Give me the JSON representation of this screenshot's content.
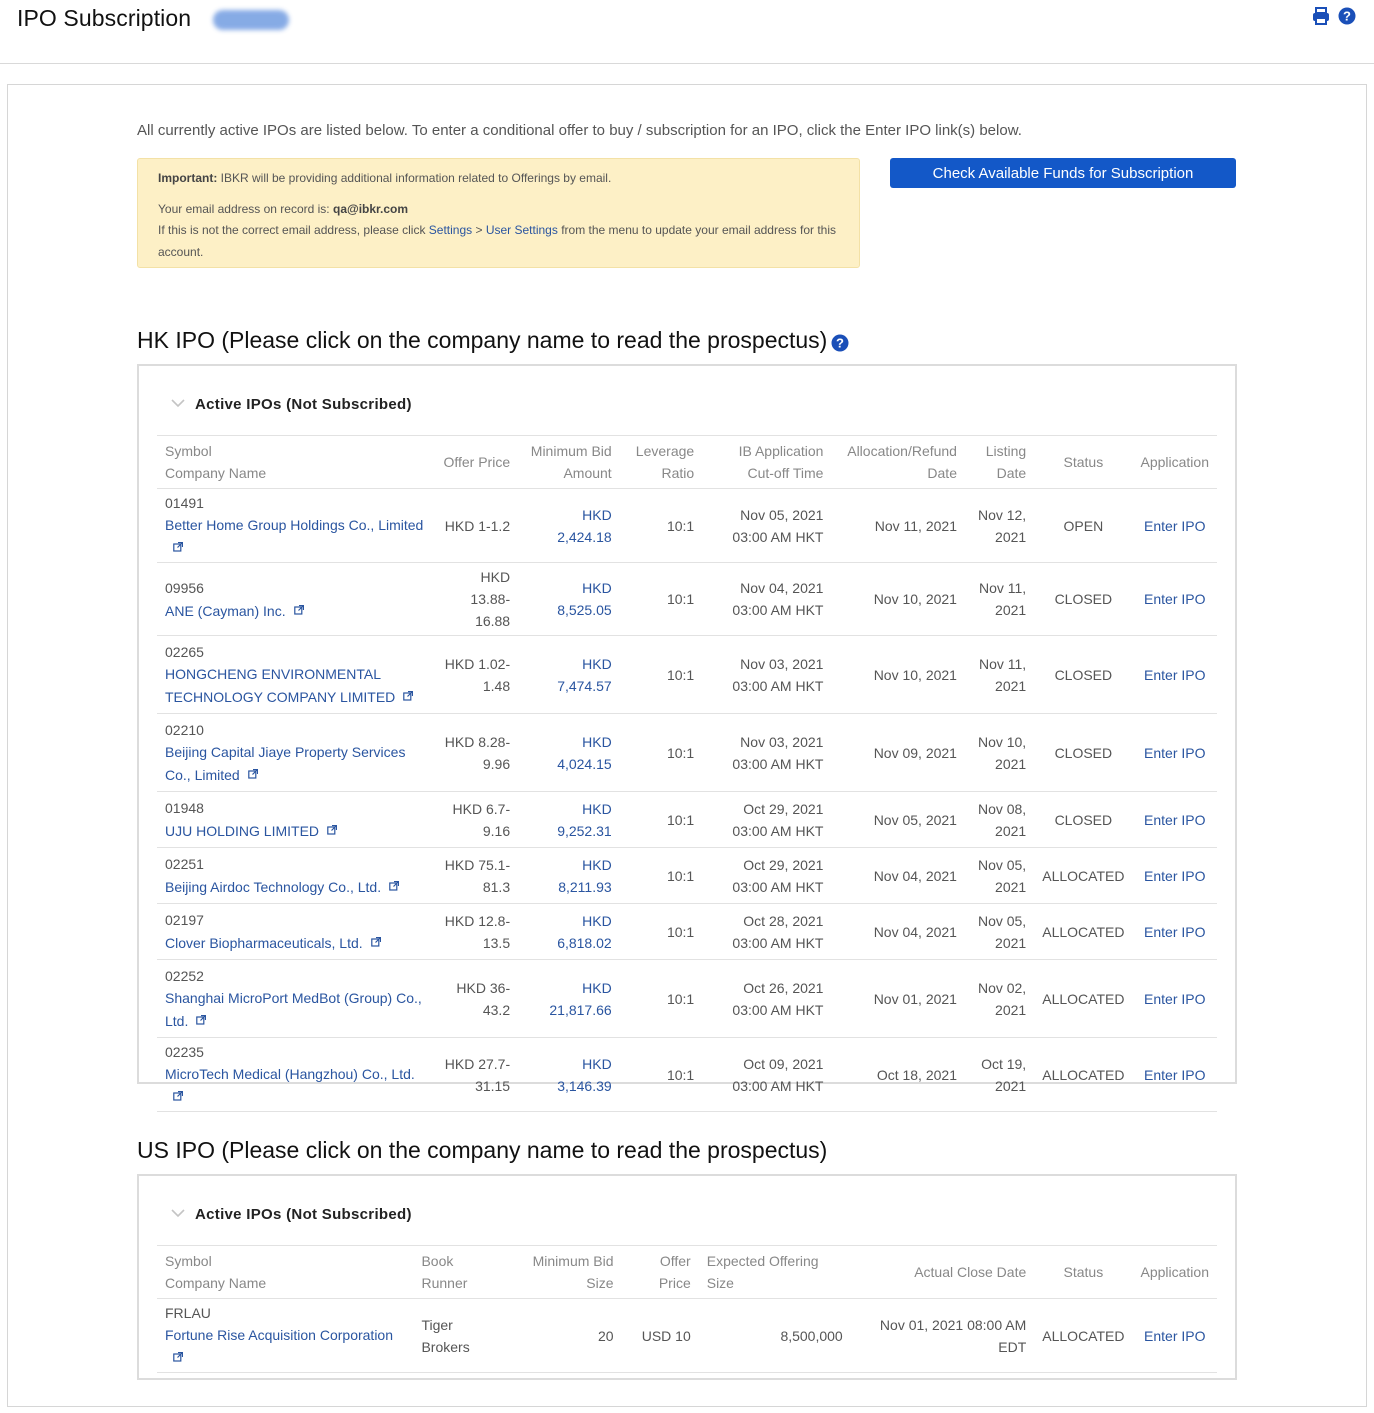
{
  "header": {
    "title": "IPO Subscription",
    "icons": [
      "print-icon",
      "help-icon"
    ]
  },
  "intro": "All currently active IPOs are listed below. To enter a conditional offer to buy / subscription for an IPO, click the Enter IPO link(s) below.",
  "notice": {
    "important_label": "Important:",
    "important_text": " IBKR will be providing additional information related to Offerings by email.",
    "email_label": "Your email address on record is: ",
    "email": "qa@ibkr.com",
    "line3_prefix": "If this is not the correct email address, please click ",
    "settings_link": "Settings",
    "separator": " > ",
    "user_settings_link": "User Settings",
    "line3_suffix": " from the menu to update your email address for this account."
  },
  "funds_button": "Check Available Funds for Subscription",
  "hk": {
    "title": "HK IPO (Please click on the company name to read the prospectus)",
    "panel_title": "Active IPOs (Not Subscribed)",
    "headers": {
      "symbol": "Symbol",
      "company": "Company Name",
      "offer_price": "Offer Price",
      "min_bid_1": "Minimum Bid",
      "min_bid_2": "Amount",
      "leverage_1": "Leverage",
      "leverage_2": "Ratio",
      "cutoff_1": "IB Application",
      "cutoff_2": "Cut-off Time",
      "alloc_1": "Allocation/Refund",
      "alloc_2": "Date",
      "listing_1": "Listing",
      "listing_2": "Date",
      "status": "Status",
      "application": "Application"
    },
    "rows": [
      {
        "symbol": "01491",
        "company": "Better Home Group Holdings Co., Limited",
        "offer_price": "HKD 1-1.2",
        "min_bid": "HKD 2,424.18",
        "leverage": "10:1",
        "cutoff": "Nov 05, 2021 03:00 AM HKT",
        "alloc": "Nov 11, 2021",
        "listing": "Nov 12, 2021",
        "status": "OPEN",
        "action": "Enter IPO"
      },
      {
        "symbol": "09956",
        "company": "ANE (Cayman) Inc.",
        "offer_price": "HKD 13.88-16.88",
        "min_bid": "HKD 8,525.05",
        "leverage": "10:1",
        "cutoff": "Nov 04, 2021 03:00 AM HKT",
        "alloc": "Nov 10, 2021",
        "listing": "Nov 11, 2021",
        "status": "CLOSED",
        "action": "Enter IPO"
      },
      {
        "symbol": "02265",
        "company": "HONGCHENG ENVIRONMENTAL TECHNOLOGY COMPANY LIMITED",
        "offer_price": "HKD 1.02-1.48",
        "min_bid": "HKD 7,474.57",
        "leverage": "10:1",
        "cutoff": "Nov 03, 2021 03:00 AM HKT",
        "alloc": "Nov 10, 2021",
        "listing": "Nov 11, 2021",
        "status": "CLOSED",
        "action": "Enter IPO"
      },
      {
        "symbol": "02210",
        "company": "Beijing Capital Jiaye Property Services Co., Limited",
        "offer_price": "HKD 8.28-9.96",
        "min_bid": "HKD 4,024.15",
        "leverage": "10:1",
        "cutoff": "Nov 03, 2021 03:00 AM HKT",
        "alloc": "Nov 09, 2021",
        "listing": "Nov 10, 2021",
        "status": "CLOSED",
        "action": "Enter IPO"
      },
      {
        "symbol": "01948",
        "company": "UJU HOLDING LIMITED",
        "offer_price": "HKD 6.7-9.16",
        "min_bid": "HKD 9,252.31",
        "leverage": "10:1",
        "cutoff": "Oct 29, 2021 03:00 AM HKT",
        "alloc": "Nov 05, 2021",
        "listing": "Nov 08, 2021",
        "status": "CLOSED",
        "action": "Enter IPO"
      },
      {
        "symbol": "02251",
        "company": "Beijing Airdoc Technology Co., Ltd.",
        "offer_price": "HKD 75.1-81.3",
        "min_bid": "HKD 8,211.93",
        "leverage": "10:1",
        "cutoff": "Oct 29, 2021 03:00 AM HKT",
        "alloc": "Nov 04, 2021",
        "listing": "Nov 05, 2021",
        "status": "ALLOCATED",
        "action": "Enter IPO"
      },
      {
        "symbol": "02197",
        "company": "Clover Biopharmaceuticals, Ltd.",
        "offer_price": "HKD 12.8-13.5",
        "min_bid": "HKD 6,818.02",
        "leverage": "10:1",
        "cutoff": "Oct 28, 2021 03:00 AM HKT",
        "alloc": "Nov 04, 2021",
        "listing": "Nov 05, 2021",
        "status": "ALLOCATED",
        "action": "Enter IPO"
      },
      {
        "symbol": "02252",
        "company": "Shanghai MicroPort MedBot (Group) Co., Ltd.",
        "offer_price": "HKD 36-43.2",
        "min_bid": "HKD 21,817.66",
        "leverage": "10:1",
        "cutoff": "Oct 26, 2021 03:00 AM HKT",
        "alloc": "Nov 01, 2021",
        "listing": "Nov 02, 2021",
        "status": "ALLOCATED",
        "action": "Enter IPO"
      },
      {
        "symbol": "02235",
        "company": "MicroTech Medical (Hangzhou) Co., Ltd.",
        "offer_price": "HKD 27.7-31.15",
        "min_bid": "HKD 3,146.39",
        "leverage": "10:1",
        "cutoff": "Oct 09, 2021 03:00 AM HKT",
        "alloc": "Oct 18, 2021",
        "listing": "Oct 19, 2021",
        "status": "ALLOCATED",
        "action": "Enter IPO"
      }
    ]
  },
  "us": {
    "title": "US IPO (Please click on the company name to read the prospectus)",
    "panel_title": "Active IPOs (Not Subscribed)",
    "headers": {
      "symbol": "Symbol",
      "company": "Company Name",
      "book_runner": "Book Runner",
      "min_bid_size": "Minimum Bid Size",
      "offer_price": "Offer Price",
      "expected_size": "Expected Offering Size",
      "close_date": "Actual Close Date",
      "status": "Status",
      "application": "Application"
    },
    "rows": [
      {
        "symbol": "FRLAU",
        "company": "Fortune Rise Acquisition Corporation",
        "book_runner": "Tiger Brokers",
        "min_bid_size": "20",
        "offer_price": "USD 10",
        "expected_size": "8,500,000",
        "close_date": "Nov 01, 2021 08:00 AM EDT",
        "status": "ALLOCATED",
        "action": "Enter IPO"
      }
    ]
  }
}
